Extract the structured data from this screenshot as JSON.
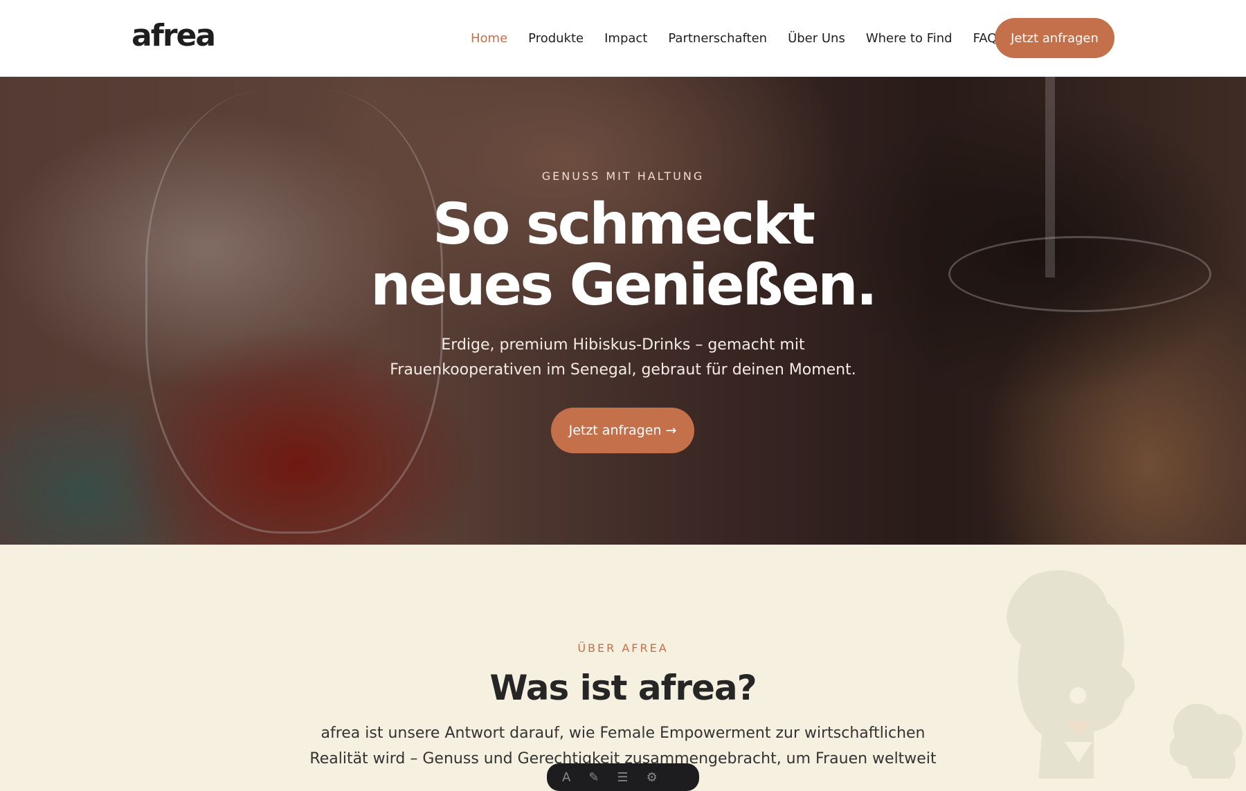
{
  "header": {
    "logo": "afrea",
    "nav": [
      {
        "label": "Home",
        "active": true
      },
      {
        "label": "Produkte"
      },
      {
        "label": "Impact"
      },
      {
        "label": "Partnerschaften"
      },
      {
        "label": "Über Uns"
      },
      {
        "label": "Where to Find"
      },
      {
        "label": "FAQ"
      }
    ],
    "cta_label": "Jetzt anfragen"
  },
  "hero": {
    "eyebrow": "GENUSS MIT HALTUNG",
    "title_line1": "So schmeckt",
    "title_line2": "neues Genießen.",
    "subtitle": "Erdige, premium Hibiskus-Drinks – gemacht mit Frauenkooperativen im Senegal, gebraut für deinen Moment.",
    "cta_label": "Jetzt anfragen →"
  },
  "about": {
    "eyebrow": "ÜBER AFREA",
    "title": "Was ist afrea?",
    "text": "afrea ist unsere Antwort darauf, wie Female Empowerment zur wirtschaftlichen Realität wird – Genuss und Gerechtigkeit zusammengebracht, um Frauen weltweit wirtschaftlich zu"
  },
  "colors": {
    "accent": "#c4704a",
    "cream": "#f5f0df",
    "text_dark": "#262626"
  }
}
